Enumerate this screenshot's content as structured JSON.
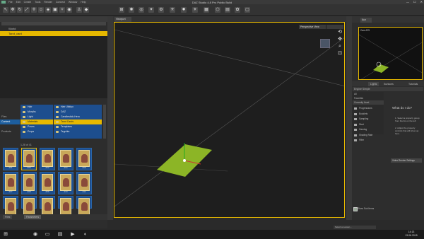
{
  "window": {
    "title": "DAZ Studio 4.8 Pro Public Build",
    "menu": [
      "File",
      "Edit",
      "Create",
      "Tools",
      "Render",
      "Connect",
      "Window",
      "Help"
    ],
    "controls": {
      "minimize": "—",
      "maximize": "☐",
      "close": "✕"
    }
  },
  "toolbar": {
    "icons": [
      "cursor-icon",
      "move-icon",
      "rotate-icon",
      "scale-icon",
      "universal-icon",
      "pose-icon",
      "node-icon",
      "render-icon",
      "spotlight-icon",
      "camera-icon",
      "figure-icon",
      "primitive-icon",
      "grid-icon",
      "lamp-icon",
      "eye-icon",
      "bulb-icon",
      "settings-icon"
    ]
  },
  "scene": {
    "header": "",
    "search_placeholder": "Enter text to filter by...",
    "rows": [
      {
        "label": "World"
      },
      {
        "label": "Tarot_card"
      }
    ]
  },
  "content_library": {
    "side_tabs": [
      "Files",
      "Content",
      "",
      "Products"
    ],
    "categories_col1": [
      "Hair",
      "Morphs",
      "Light",
      "Materials",
      "Poses",
      "Props"
    ],
    "categories_col2": [
      "Hair Ukkiyo",
      "DAZ",
      "Candlestick-Hero",
      "Tarot Cards",
      "Templates",
      "Tegnhla"
    ],
    "selected_col1": "Materials",
    "selected_col2": "Tarot Cards",
    "page_info": "1-28 of 41",
    "thumbs": [
      {
        "label": "d01"
      },
      {
        "label": "d05"
      },
      {
        "label": "d02"
      },
      {
        "label": "d04"
      },
      {
        "label": "d06"
      },
      {
        "label": "d07"
      },
      {
        "label": "d08"
      },
      {
        "label": "d09"
      },
      {
        "label": "d10"
      },
      {
        "label": "d11"
      },
      {
        "label": "d12"
      },
      {
        "label": "d13"
      },
      {
        "label": "d14"
      },
      {
        "label": "d15"
      },
      {
        "label": "d16"
      },
      {
        "label": "d17"
      },
      {
        "label": "d18"
      },
      {
        "label": "d19"
      }
    ],
    "bottom_tabs": [
      "Files",
      "Parameters"
    ]
  },
  "viewport": {
    "tab": "Viewport",
    "camera": "Perspective View",
    "nav_icons": [
      "orbit-icon",
      "pan-icon",
      "zoom-icon",
      "frame-icon",
      "reset-icon"
    ],
    "plane_color": "#8cb526"
  },
  "aux": {
    "tab": "Aux",
    "label": "Cam    AT5"
  },
  "right_panel": {
    "tabs": [
      "Lights",
      "Surfaces",
      "Tutorials"
    ],
    "smart_header": "Engine  Simple",
    "smart_list": [
      "All",
      "Favorites",
      "Currently Used"
    ],
    "tree": [
      "Progressions",
      "Booklets",
      "Sampling",
      "Start",
      "Gaming",
      "Shading Rate",
      "Filter"
    ],
    "guide": {
      "heading": "What do I do?",
      "steps": [
        "1. Select a property group from the list on the left",
        "2. Adjust the property controls that will show up here."
      ]
    },
    "render_button": "Video Render Settings",
    "show_sub": "Show Sub Items"
  },
  "lesson": {
    "placeholder": "Select a Lesson..."
  },
  "taskbar": {
    "time": "14:13",
    "date": "13.06.2015",
    "apps": [
      "windows-icon",
      "chrome-icon",
      "taskview-icon",
      "explorer-icon",
      "terminal-icon",
      "daz-icon"
    ]
  },
  "colors": {
    "accent": "#e6b800",
    "selection_blue": "#1d4e8e",
    "background": "#2a2a2a"
  }
}
